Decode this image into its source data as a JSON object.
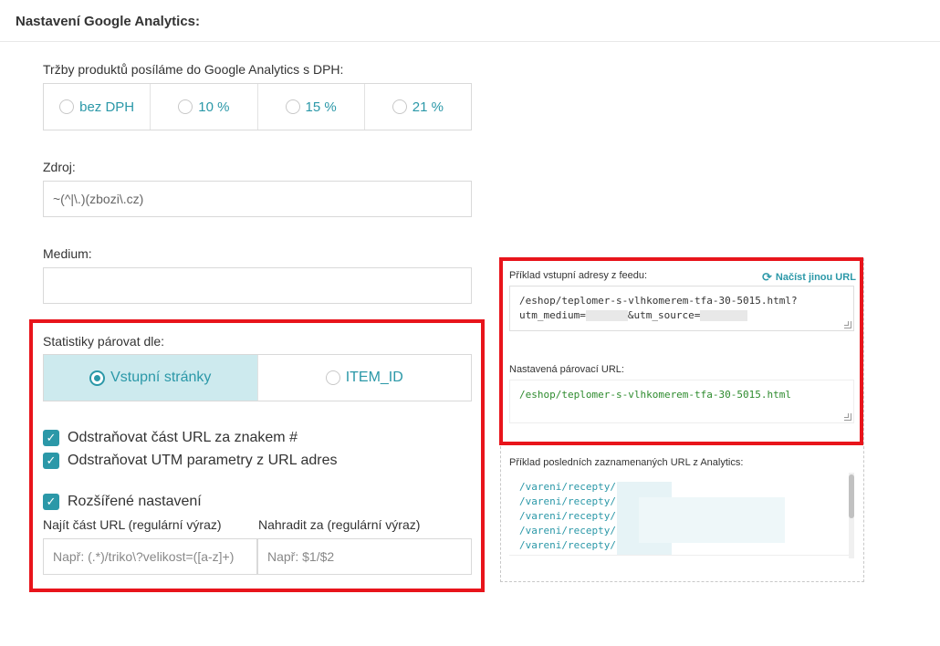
{
  "page": {
    "title": "Nastavení Google Analytics:"
  },
  "vat": {
    "label": "Tržby produktů posíláme do Google Analytics s DPH:",
    "options": [
      "bez DPH",
      "10 %",
      "15 %",
      "21 %"
    ]
  },
  "source": {
    "label": "Zdroj:",
    "value": "~(^|\\.)(zbozi\\.cz)"
  },
  "medium": {
    "label": "Medium:",
    "value": ""
  },
  "match": {
    "label": "Statistiky párovat dle:",
    "options": [
      "Vstupní stránky",
      "ITEM_ID"
    ],
    "selected": "Vstupní stránky"
  },
  "checks": {
    "strip_hash": "Odstraňovat část URL za znakem #",
    "strip_utm": "Odstraňovat UTM parametry z URL adres",
    "advanced": "Rozšířené nastavení"
  },
  "regex": {
    "find_label": "Najít část URL (regulární výraz)",
    "find_placeholder": "Např: (.*)/triko\\?velikost=([a-z]+)",
    "replace_label": "Nahradit za (regulární výraz)",
    "replace_placeholder": "Např: $1/$2"
  },
  "feed": {
    "label": "Příklad vstupní adresy z feedu:",
    "reload": "Načíst jinou URL",
    "url_line1": "/eshop/teplomer-s-vlhkomerem-tfa-30-5015.html?",
    "url_line2_a": "utm_medium=",
    "url_line2_b": "&utm_source="
  },
  "paired": {
    "label": "Nastavená párovací URL:",
    "url": "/eshop/teplomer-s-vlhkomerem-tfa-30-5015.html"
  },
  "recent": {
    "label": "Příklad posledních zaznamenaných URL z Analytics:",
    "urls": [
      "/vareni/recepty/",
      "/vareni/recepty/",
      "/vareni/recepty/",
      "/vareni/recepty/",
      "/vareni/recepty/"
    ]
  },
  "colors": {
    "accent": "#2b98a8",
    "highlight": "#e8141b",
    "selected_bg": "#cdeaee"
  }
}
